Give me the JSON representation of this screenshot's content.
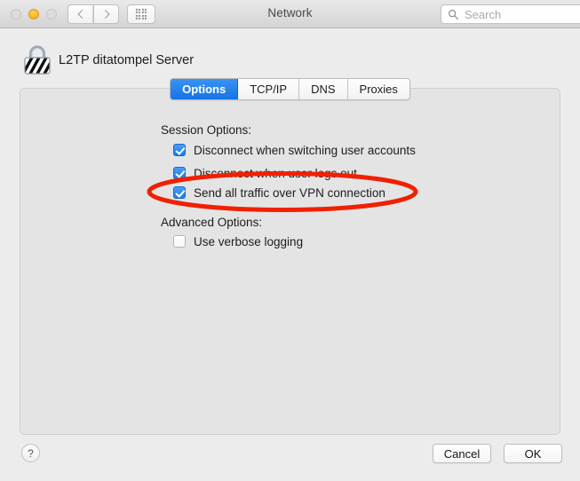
{
  "window": {
    "title": "Network",
    "traffic_lights": [
      {
        "name": "close",
        "state": "inactive"
      },
      {
        "name": "minimize",
        "state": "active",
        "color": "#f7b731"
      },
      {
        "name": "zoom",
        "state": "inactive"
      }
    ],
    "nav": {
      "back_icon": "chevron-left-icon",
      "forward_icon": "chevron-right-icon",
      "grid_icon": "show-all-grid-icon"
    },
    "search": {
      "icon": "search-icon",
      "placeholder": "Search",
      "value": ""
    }
  },
  "header": {
    "icon": "vpn-lock-icon",
    "title": "L2TP ditatompel Server"
  },
  "tabs": [
    {
      "label": "Options",
      "selected": true
    },
    {
      "label": "TCP/IP",
      "selected": false
    },
    {
      "label": "DNS",
      "selected": false
    },
    {
      "label": "Proxies",
      "selected": false
    }
  ],
  "sections": {
    "session": {
      "label": "Session Options:",
      "options": [
        {
          "label": "Disconnect when switching user accounts",
          "checked": true
        },
        {
          "label": "Disconnect when user logs out",
          "checked": true
        },
        {
          "label": "Send all traffic over VPN connection",
          "checked": true
        }
      ]
    },
    "advanced": {
      "label": "Advanced Options:",
      "options": [
        {
          "label": "Use verbose logging",
          "checked": false
        }
      ]
    }
  },
  "annotation": {
    "shape": "ellipse",
    "color": "#f02000",
    "targets": "Send all traffic over VPN connection"
  },
  "footer": {
    "help_label": "?",
    "cancel_label": "Cancel",
    "ok_label": "OK"
  },
  "colors": {
    "accent_blue": "#1b7ced",
    "annotation_red": "#f02000",
    "panel_background": "#e4e4e4",
    "window_background": "#ececec"
  }
}
